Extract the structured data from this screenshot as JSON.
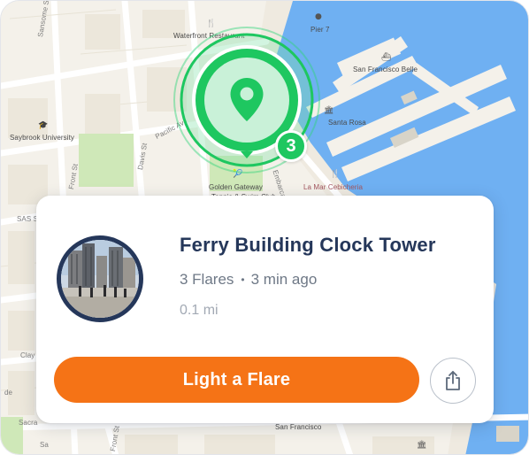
{
  "map": {
    "labels": {
      "waterfront_restaurant": "Waterfront Restaurant",
      "pier7": "Pier 7",
      "sf_belle": "San Francisco Belle",
      "saybrook": "Saybrook University",
      "pacific": "Pacific Av",
      "davis": "Davis St",
      "front": "Front St",
      "sansome": "Sansome St",
      "santa_rosa": "Santa Rosa",
      "la_mar": "La Mar Cebicheria",
      "golden_gateway": "Golden Gateway",
      "tennis": "Tennis & Swim Club",
      "embarcadero": "Embarcadero",
      "sas_st": "SAS St",
      "clay": "Clay",
      "sacra": "Sacra",
      "sf_bottom": "San Francisco",
      "front_bottom": "Front St",
      "de": "de",
      "sa": "Sa"
    }
  },
  "marker": {
    "count": "3"
  },
  "card": {
    "title": "Ferry Building Clock Tower",
    "flares": "3 Flares",
    "separator": "•",
    "time_ago": "3 min ago",
    "distance": "0.1 mi",
    "cta_label": "Light a Flare"
  },
  "colors": {
    "accent_orange": "#F57316",
    "marker_green": "#1EC760",
    "title_navy": "#25375A",
    "water": "#6FB0F2"
  },
  "icons": {
    "share": "share-icon",
    "pin": "location-pin-icon"
  }
}
